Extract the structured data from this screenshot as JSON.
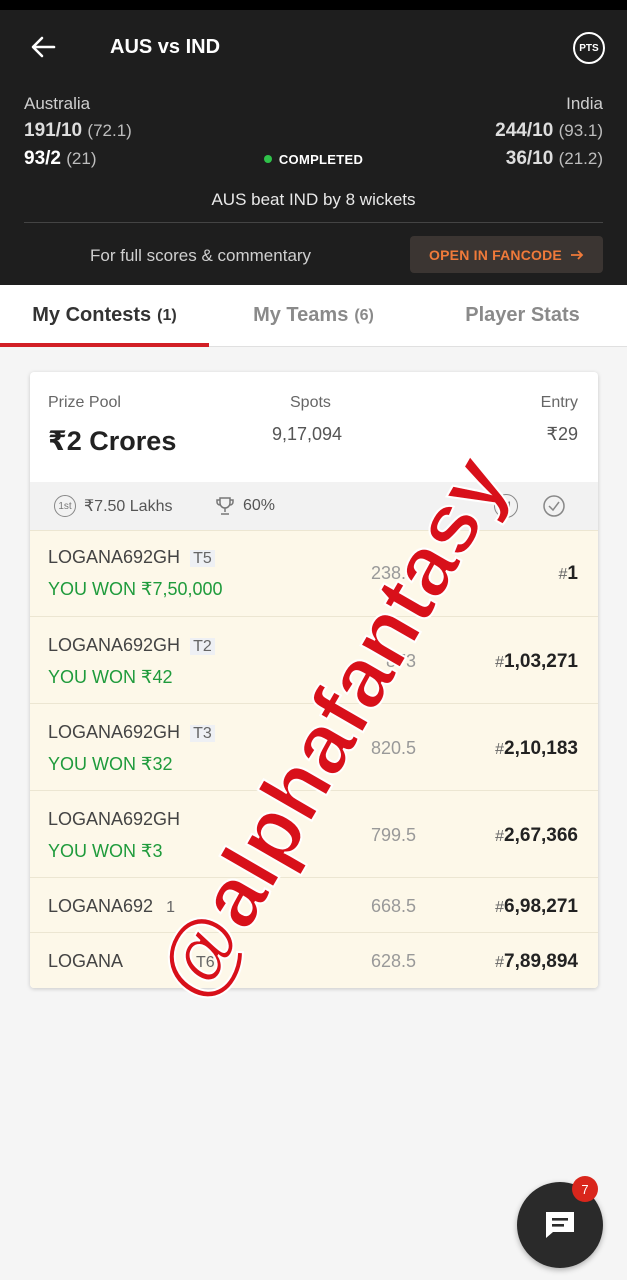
{
  "header": {
    "title": "AUS vs IND",
    "pts_label": "PTS",
    "team1": {
      "name": "Australia",
      "inn1": "191/10",
      "inn1_overs": "(72.1)",
      "inn2": "93/2",
      "inn2_overs": "(21)"
    },
    "team2": {
      "name": "India",
      "inn1": "244/10",
      "inn1_overs": "(93.1)",
      "inn2": "36/10",
      "inn2_overs": "(21.2)"
    },
    "status": "COMPLETED",
    "result": "AUS beat IND by 8 wickets",
    "full_scores": "For full scores & commentary",
    "fancode_button": "OPEN IN FANCODE"
  },
  "tabs": [
    {
      "label": "My Contests",
      "count": "(1)"
    },
    {
      "label": "My Teams",
      "count": "(6)"
    },
    {
      "label": "Player Stats",
      "count": ""
    }
  ],
  "contest": {
    "prize_pool_label": "Prize Pool",
    "prize_pool": "₹2 Crores",
    "spots_label": "Spots",
    "spots": "9,17,094",
    "entry_label": "Entry",
    "entry": "₹29",
    "first_prize_icon": "1st",
    "first_prize": "₹7.50 Lakhs",
    "winners_pct": "60%",
    "multi_icon": "M",
    "rows": [
      {
        "team": "LOGANA692GH",
        "tag": "T5",
        "won": "YOU WON ₹7,50,000",
        "points": "238.5",
        "rank": "1"
      },
      {
        "team": "LOGANA692GH",
        "tag": "T2",
        "won": "YOU WON ₹42",
        "points": "873",
        "rank": "1,03,271"
      },
      {
        "team": "LOGANA692GH",
        "tag": "T3",
        "won": "YOU WON ₹32",
        "points": "820.5",
        "rank": "2,10,183"
      },
      {
        "team": "LOGANA692GH",
        "tag": "",
        "won": "YOU WON ₹3",
        "points": "799.5",
        "rank": "2,67,366"
      },
      {
        "team": "LOGANA692",
        "tag": "1",
        "won": "",
        "points": "668.5",
        "rank": "6,98,271"
      },
      {
        "team": "LOGANA",
        "tag": "T6",
        "won": "",
        "points": "628.5",
        "rank": "7,89,894"
      }
    ]
  },
  "watermark": "@alphafantasy",
  "chat_badge": "7"
}
